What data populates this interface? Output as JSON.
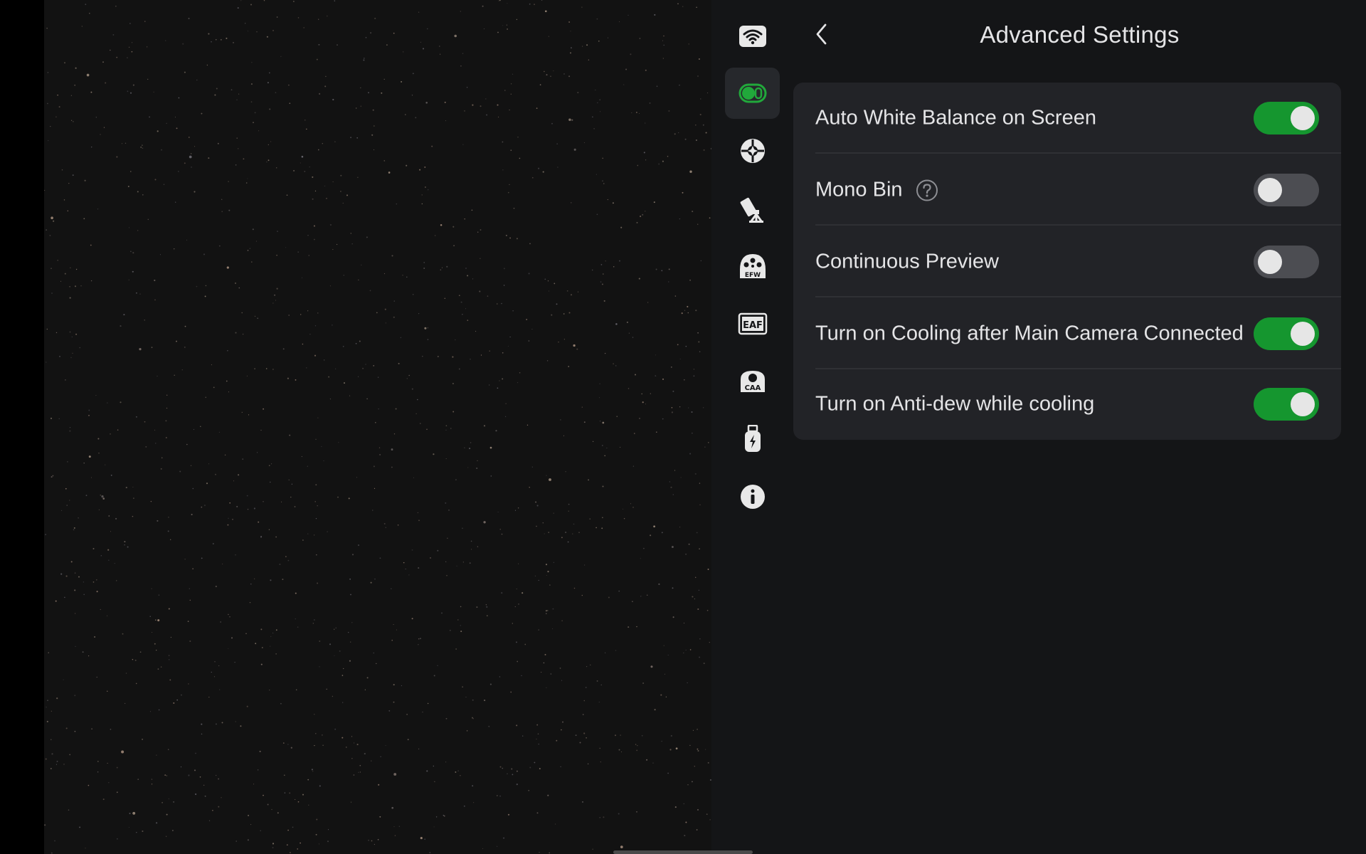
{
  "header": {
    "title": "Advanced Settings",
    "back_icon": "chevron-left-icon"
  },
  "sidebar": {
    "items": [
      {
        "icon": "wifi-icon",
        "active": false
      },
      {
        "icon": "camera-toggle-icon",
        "active": true,
        "accent": "#21a83b"
      },
      {
        "icon": "crosshair-icon",
        "active": false
      },
      {
        "icon": "telescope-icon",
        "active": false
      },
      {
        "icon": "efw-icon",
        "label": "EFW",
        "active": false
      },
      {
        "icon": "eaf-icon",
        "label": "EAF",
        "active": false
      },
      {
        "icon": "caa-icon",
        "label": "CAA",
        "active": false
      },
      {
        "icon": "usb-power-icon",
        "active": false
      },
      {
        "icon": "info-icon",
        "active": false
      }
    ]
  },
  "settings": [
    {
      "label": "Auto White Balance on Screen",
      "enabled": true
    },
    {
      "label": "Mono Bin",
      "enabled": false,
      "help_icon": "help-icon"
    },
    {
      "label": "Continuous Preview",
      "enabled": false
    },
    {
      "label": "Turn on Cooling after Main Camera Connected",
      "enabled": true
    },
    {
      "label": "Turn on Anti-dew while cooling",
      "enabled": true
    }
  ],
  "colors": {
    "toggle_on": "#15962f",
    "toggle_off": "#4c4d52",
    "panel_bg": "#141517",
    "card_bg": "#222327",
    "text": "#e4e4e6"
  }
}
